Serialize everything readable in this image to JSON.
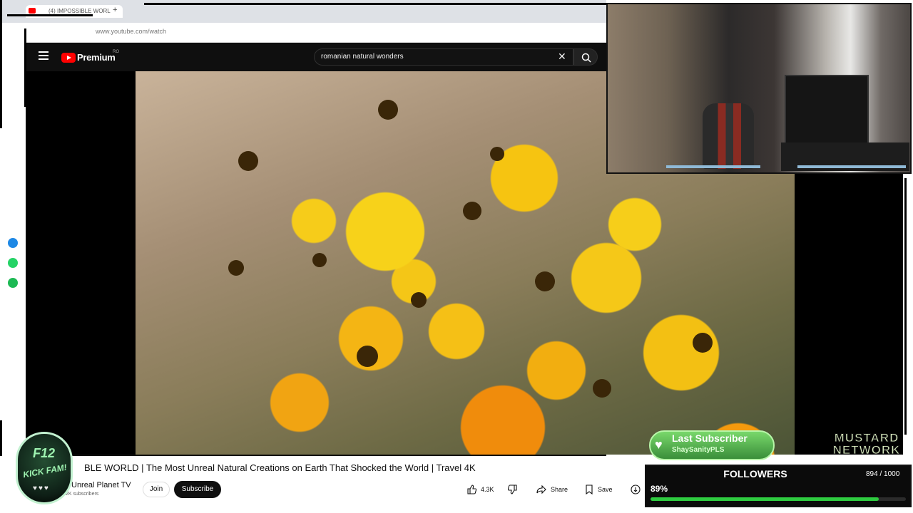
{
  "browser": {
    "tab_title": "(4) IMPOSSIBLE WORL",
    "new_tab": "+",
    "url": "www.youtube.com/watch"
  },
  "youtube": {
    "brand": "Premium",
    "country": "RO",
    "search_query": "romanian natural wonders",
    "clear_icon": "close-icon",
    "search_icon": "search-icon"
  },
  "video": {
    "title": "BLE WORLD | The Most Unreal Natural Creations on Earth That Shocked the World | Travel 4K",
    "channel": "Unreal Planet TV",
    "subscribers": "2K subscribers",
    "join_label": "Join",
    "subscribe_label": "Subscribe",
    "likes": "4.3K",
    "share_label": "Share",
    "save_label": "Save"
  },
  "overlay": {
    "badge_line1": "F12",
    "badge_line2": "KICK FAM!",
    "badge_hearts": "♥♥♥",
    "last_sub_label": "Last Subscriber",
    "last_sub_name": "ShaySanityPLS",
    "network_line1": "MUSTARD",
    "network_line2": "NETWORK",
    "followers_label": "FOLLOWERS",
    "followers_count": "894 / 1000",
    "followers_percent": "89%",
    "followers_fraction": 0.894
  },
  "colors": {
    "youtube_red": "#ff0000",
    "dark_bg": "#0f0f0f",
    "progress_green": "#2ecc40"
  }
}
